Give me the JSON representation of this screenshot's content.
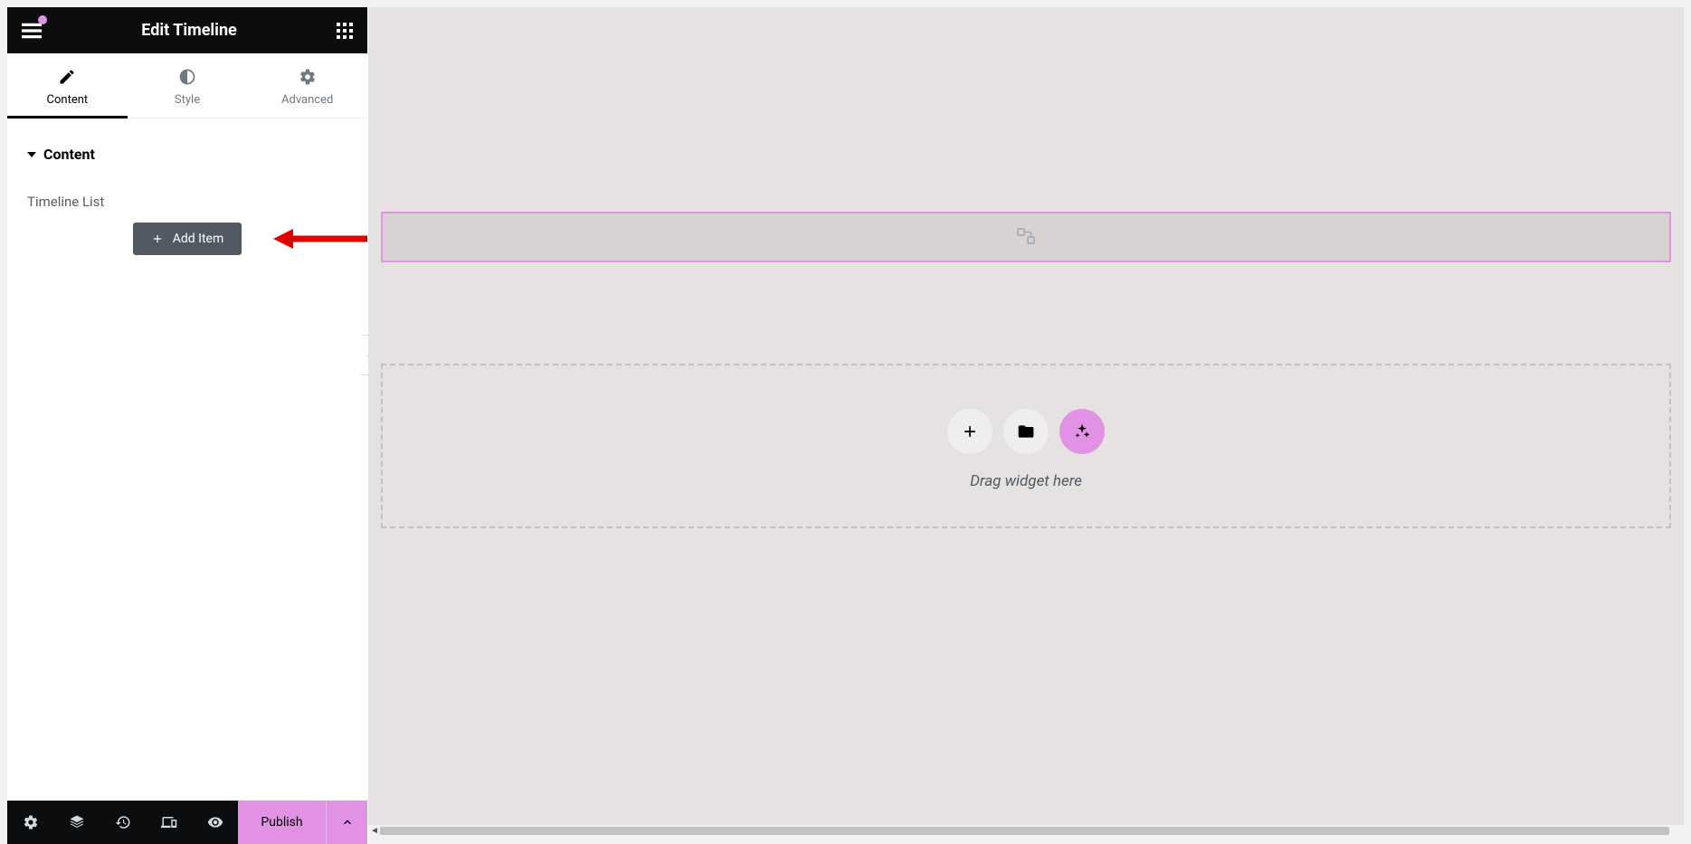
{
  "header": {
    "title": "Edit Timeline"
  },
  "tabs": {
    "content": "Content",
    "style": "Style",
    "advanced": "Advanced"
  },
  "section": {
    "title": "Content",
    "field_label": "Timeline List",
    "add_item": "Add Item"
  },
  "footer": {
    "publish": "Publish"
  },
  "drop_zone": {
    "text": "Drag widget here"
  }
}
